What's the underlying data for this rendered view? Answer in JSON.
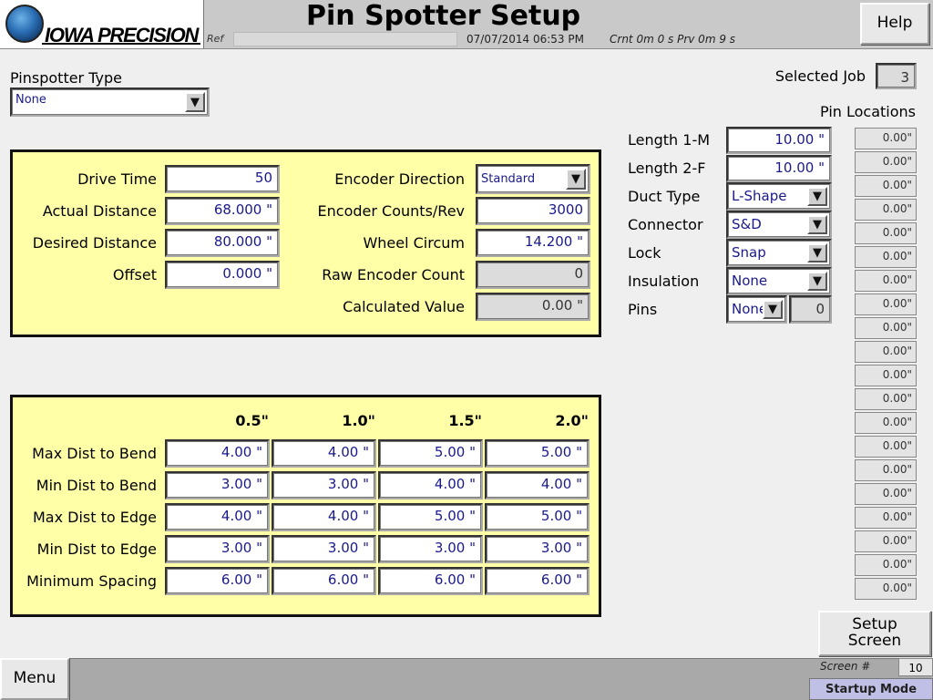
{
  "header": {
    "logo_text": "IOWA PRECISION",
    "title": "Pin Spotter Setup",
    "ref_label": "Ref",
    "datetime": "07/07/2014 06:53 PM",
    "timing": "Crnt  0m  0 s  Prv  0m  9 s",
    "help_label": "Help"
  },
  "pinspotter": {
    "label": "Pinspotter Type",
    "value": "None"
  },
  "job": {
    "label": "Selected Job",
    "value": "3"
  },
  "pin_locations": {
    "label": "Pin Locations",
    "values": [
      "0.00\"",
      "0.00\"",
      "0.00\"",
      "0.00\"",
      "0.00\"",
      "0.00\"",
      "0.00\"",
      "0.00\"",
      "0.00\"",
      "0.00\"",
      "0.00\"",
      "0.00\"",
      "0.00\"",
      "0.00\"",
      "0.00\"",
      "0.00\"",
      "0.00\"",
      "0.00\"",
      "0.00\"",
      "0.00\""
    ]
  },
  "drive": {
    "drive_time_label": "Drive Time",
    "drive_time": "50",
    "actual_distance_label": "Actual Distance",
    "actual_distance": "68.000 \"",
    "desired_distance_label": "Desired Distance",
    "desired_distance": "80.000 \"",
    "offset_label": "Offset",
    "offset": "0.000 \""
  },
  "encoder": {
    "direction_label": "Encoder Direction",
    "direction": "Standard",
    "counts_label": "Encoder Counts/Rev",
    "counts": "3000",
    "wheel_label": "Wheel Circum",
    "wheel": "14.200 \"",
    "raw_label": "Raw Encoder Count",
    "raw": "0",
    "calc_label": "Calculated Value",
    "calc": "0.00 \""
  },
  "duct": {
    "length1_label": "Length 1-M",
    "length1": "10.00 \"",
    "length2_label": "Length 2-F",
    "length2": "10.00 \"",
    "duct_type_label": "Duct Type",
    "duct_type": "L-Shape",
    "connector_label": "Connector",
    "connector": "S&D",
    "lock_label": "Lock",
    "lock": "Snap",
    "insulation_label": "Insulation",
    "insulation": "None",
    "pins_label": "Pins",
    "pins": "None",
    "pins_count": "0"
  },
  "spacing": {
    "columns": [
      "0.5\"",
      "1.0\"",
      "1.5\"",
      "2.0\""
    ],
    "rows": [
      {
        "label": "Max Dist to Bend",
        "values": [
          "4.00 \"",
          "4.00 \"",
          "5.00 \"",
          "5.00 \""
        ]
      },
      {
        "label": "Min Dist to Bend",
        "values": [
          "3.00 \"",
          "3.00 \"",
          "4.00 \"",
          "4.00 \""
        ]
      },
      {
        "label": "Max Dist to Edge",
        "values": [
          "4.00 \"",
          "4.00 \"",
          "5.00 \"",
          "5.00 \""
        ]
      },
      {
        "label": "Min Dist to Edge",
        "values": [
          "3.00 \"",
          "3.00 \"",
          "3.00 \"",
          "3.00 \""
        ]
      },
      {
        "label": "Minimum Spacing",
        "values": [
          "6.00 \"",
          "6.00 \"",
          "6.00 \"",
          "6.00 \""
        ]
      }
    ]
  },
  "footer": {
    "menu_label": "Menu",
    "setup_label": "Setup Screen",
    "screen_label": "Screen #",
    "screen_number": "10",
    "mode": "Startup Mode"
  },
  "icons": {
    "dropdown": "chevron-down-icon",
    "logo": "globe-icon"
  }
}
